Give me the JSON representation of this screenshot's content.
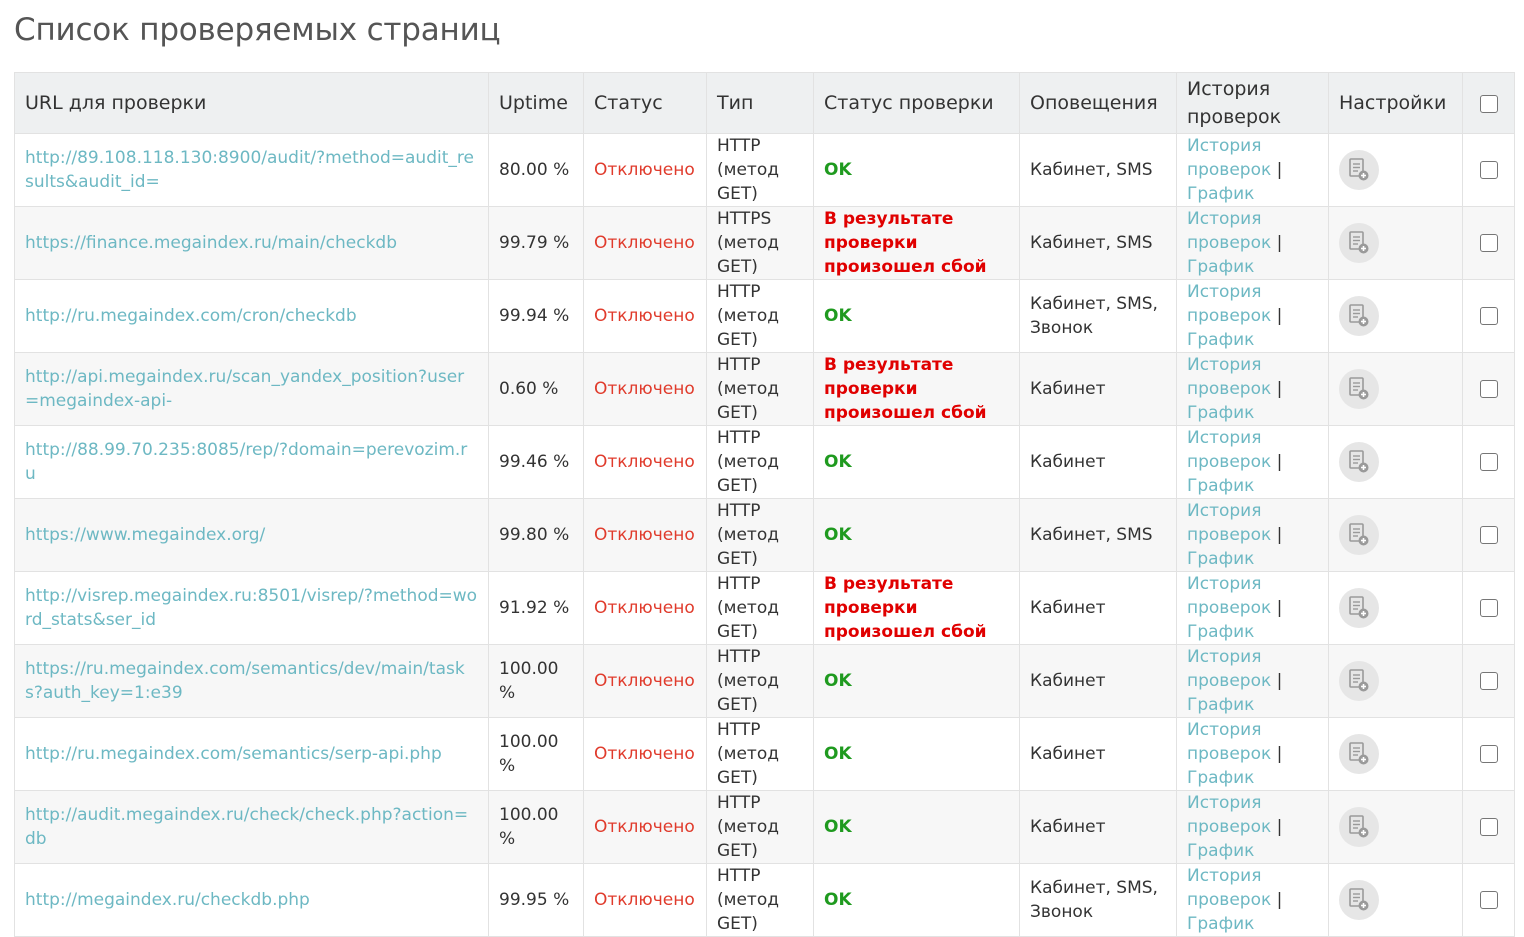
{
  "page": {
    "title": "Список проверяемых страниц"
  },
  "table": {
    "headers": {
      "url": "URL для проверки",
      "uptime": "Uptime",
      "status": "Статус",
      "type": "Тип",
      "check_status": "Статус проверки",
      "notifications": "Оповещения",
      "history": "История проверок",
      "settings": "Настройки"
    },
    "history_link": "История проверок",
    "history_sep": "|",
    "chart_link": "График",
    "rows": [
      {
        "url": "http://89.108.118.130:8900/audit/?method=audit_results&audit_id=",
        "uptime": "80.00 %",
        "status": "Отключено",
        "type": "HTTP (метод GET)",
        "check": "OK",
        "check_ok": true,
        "notify": "Кабинет, SMS"
      },
      {
        "url": "https://finance.megaindex.ru/main/checkdb",
        "uptime": "99.79 %",
        "status": "Отключено",
        "type": "HTTPS (метод GET)",
        "check": "В результате проверки произошел сбой",
        "check_ok": false,
        "notify": "Кабинет, SMS"
      },
      {
        "url": "http://ru.megaindex.com/cron/checkdb",
        "uptime": "99.94 %",
        "status": "Отключено",
        "type": "HTTP (метод GET)",
        "check": "OK",
        "check_ok": true,
        "notify": "Кабинет, SMS, Звонок"
      },
      {
        "url": "http://api.megaindex.ru/scan_yandex_position?user=megaindex-api-",
        "uptime": "0.60 %",
        "status": "Отключено",
        "type": "HTTP (метод GET)",
        "check": "В результате проверки произошел сбой",
        "check_ok": false,
        "notify": "Кабинет"
      },
      {
        "url": "http://88.99.70.235:8085/rep/?domain=perevozim.ru",
        "uptime": "99.46 %",
        "status": "Отключено",
        "type": "HTTP (метод GET)",
        "check": "OK",
        "check_ok": true,
        "notify": "Кабинет"
      },
      {
        "url": "https://www.megaindex.org/",
        "uptime": "99.80 %",
        "status": "Отключено",
        "type": "HTTP (метод GET)",
        "check": "OK",
        "check_ok": true,
        "notify": "Кабинет, SMS"
      },
      {
        "url": "http://visrep.megaindex.ru:8501/visrep/?method=word_stats&ser_id",
        "uptime": "91.92 %",
        "status": "Отключено",
        "type": "HTTP (метод GET)",
        "check": "В результате проверки произошел сбой",
        "check_ok": false,
        "notify": "Кабинет"
      },
      {
        "url": "https://ru.megaindex.com/semantics/dev/main/tasks?auth_key=1:e39",
        "uptime": "100.00 %",
        "status": "Отключено",
        "type": "HTTP (метод GET)",
        "check": "OK",
        "check_ok": true,
        "notify": "Кабинет"
      },
      {
        "url": "http://ru.megaindex.com/semantics/serp-api.php",
        "uptime": "100.00 %",
        "status": "Отключено",
        "type": "HTTP (метод GET)",
        "check": "OK",
        "check_ok": true,
        "notify": "Кабинет"
      },
      {
        "url": "http://audit.megaindex.ru/check/check.php?action=db",
        "uptime": "100.00 %",
        "status": "Отключено",
        "type": "HTTP (метод GET)",
        "check": "OK",
        "check_ok": true,
        "notify": "Кабинет"
      },
      {
        "url": "http://megaindex.ru/checkdb.php",
        "uptime": "99.95 %",
        "status": "Отключено",
        "type": "HTTP (метод GET)",
        "check": "OK",
        "check_ok": true,
        "notify": "Кабинет, SMS, Звонок"
      }
    ]
  },
  "colors": {
    "link": "#6db8c3",
    "status_off": "#e03b2c",
    "check_ok": "#1f9a1f",
    "check_fail": "#e00000",
    "header_bg": "#eef0f1"
  },
  "icons": {
    "settings": "document-add-icon",
    "select": "checkbox"
  }
}
